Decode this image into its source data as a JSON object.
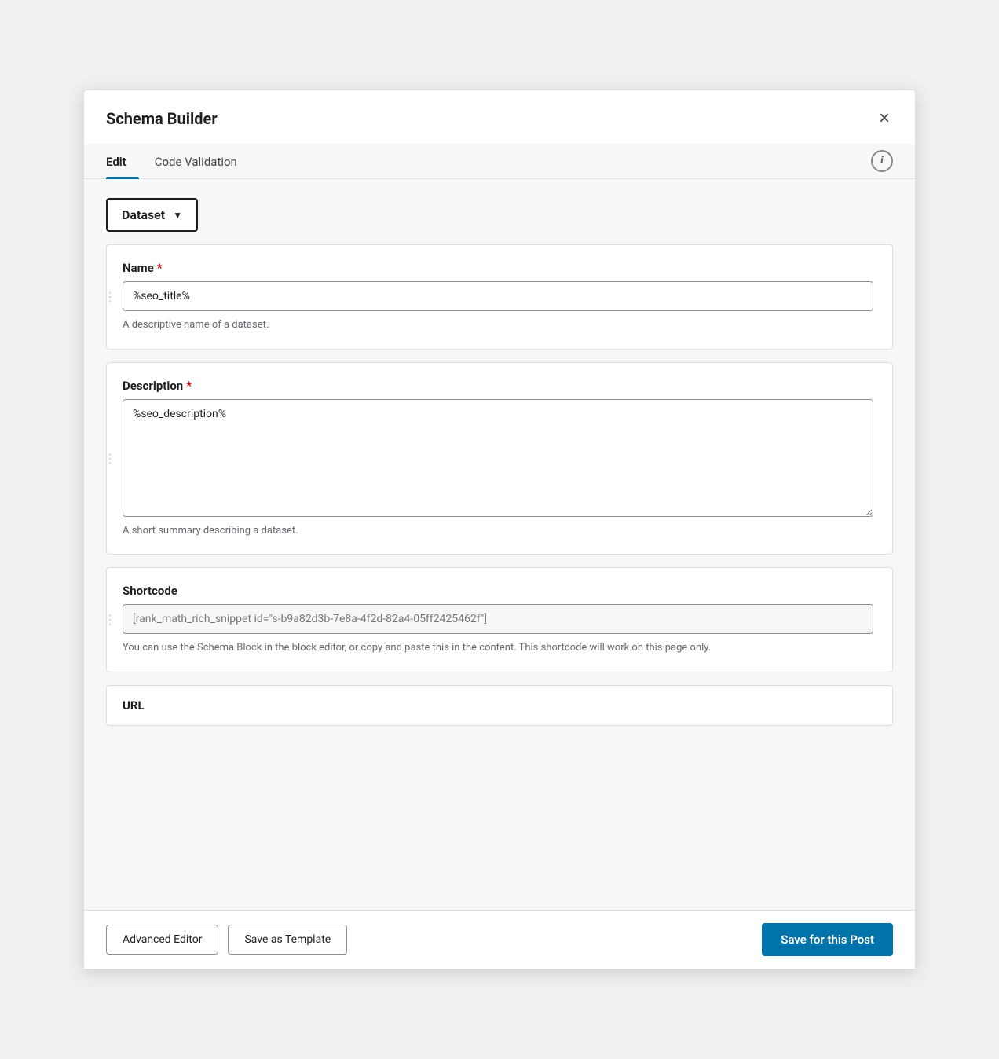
{
  "modal": {
    "title": "Schema Builder",
    "close_label": "×"
  },
  "tabs": {
    "edit_label": "Edit",
    "code_validation_label": "Code Validation",
    "info_icon_label": "i"
  },
  "schema_type": {
    "label": "Dataset"
  },
  "fields": {
    "name": {
      "label": "Name",
      "required": true,
      "value": "%seo_title%",
      "hint": "A descriptive name of a dataset."
    },
    "description": {
      "label": "Description",
      "required": true,
      "value": "%seo_description%",
      "hint": "A short summary describing a dataset."
    },
    "shortcode": {
      "label": "Shortcode",
      "placeholder": "[rank_math_rich_snippet id=\"s-b9a82d3b-7e8a-4f2d-82a4-05ff2425462f\"]",
      "hint": "You can use the Schema Block in the block editor, or copy and paste this in the content. This shortcode will work on this page only."
    },
    "url": {
      "label": "URL"
    }
  },
  "footer": {
    "advanced_editor_label": "Advanced Editor",
    "save_template_label": "Save as Template",
    "save_post_label": "Save for this Post"
  }
}
